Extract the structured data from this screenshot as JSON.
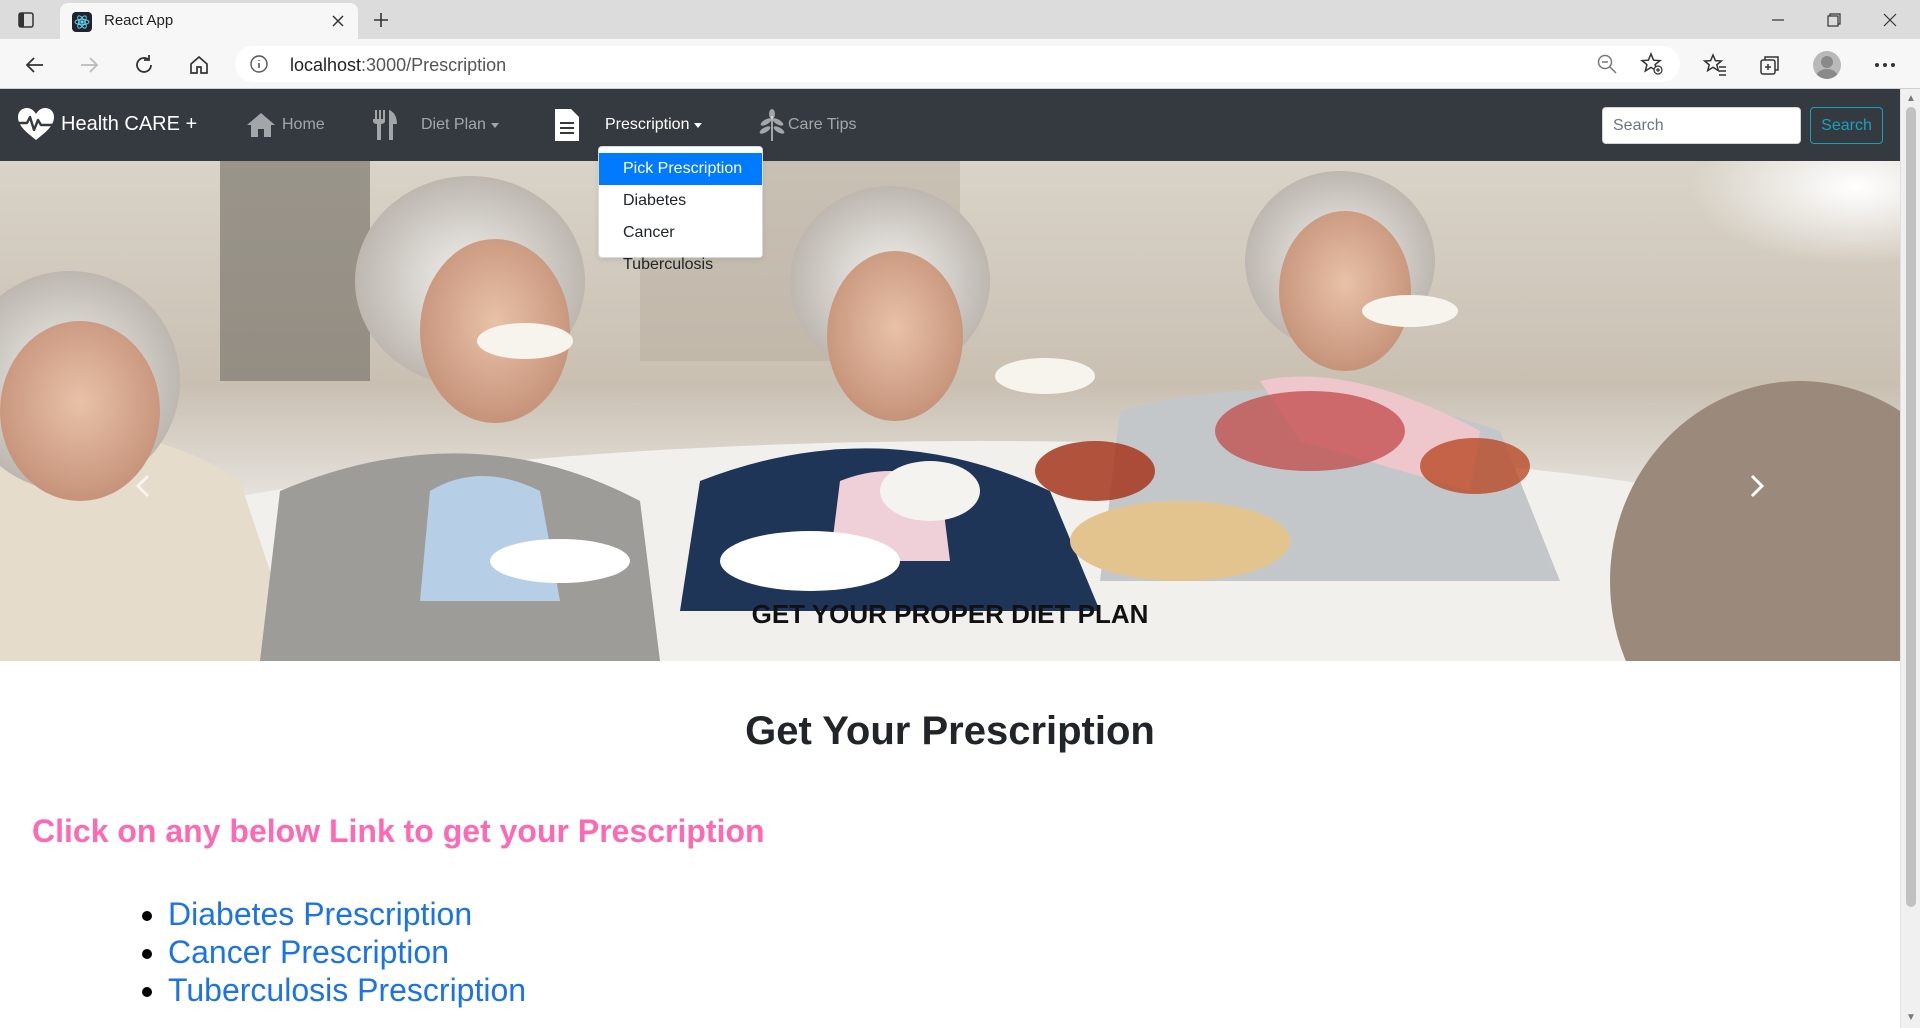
{
  "browser": {
    "tab_title": "React App",
    "url_host": "localhost",
    "url_path": ":3000/Prescription"
  },
  "navbar": {
    "brand": "Health CARE +",
    "items": [
      {
        "label": "Home",
        "icon": "home-icon"
      },
      {
        "label": "Diet Plan",
        "icon": "cutlery-icon",
        "has_caret": true
      },
      {
        "label": "Prescription",
        "icon": "document-icon",
        "has_caret": true,
        "active": true
      },
      {
        "label": "Care Tips",
        "icon": "leaf-icon"
      }
    ],
    "search_placeholder": "Search",
    "search_button": "Search"
  },
  "dropdown": {
    "items": [
      "Pick Prescription",
      "Diabetes",
      "Cancer",
      "Tuberculosis"
    ],
    "active_index": 0
  },
  "carousel": {
    "caption": "GET YOUR PROPER DIET PLAN"
  },
  "main": {
    "title": "Get Your Prescription",
    "instruction": "Click on any below Link to get your Prescription",
    "links": [
      "Diabetes Prescription",
      "Cancer Prescription",
      "Tuberculosis Prescription"
    ]
  },
  "colors": {
    "navbar_bg": "#343a40",
    "accent_blue": "#007bff",
    "search_outline": "#17a2b8",
    "instruction_pink": "#ff69b4",
    "link_blue": "#1a73e8"
  }
}
